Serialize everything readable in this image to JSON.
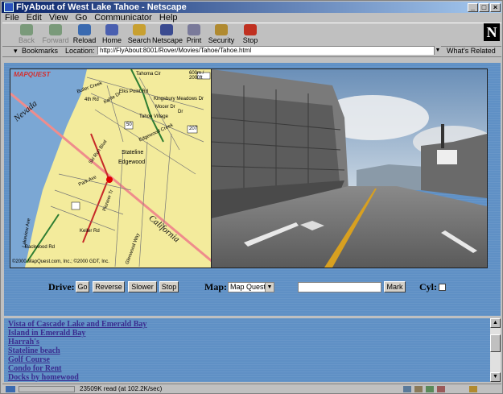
{
  "window": {
    "title": "FlyAbout of West Lake Tahoe - Netscape",
    "controls": [
      "_",
      "□",
      "×"
    ]
  },
  "menubar": [
    "File",
    "Edit",
    "View",
    "Go",
    "Communicator",
    "Help"
  ],
  "toolbar": {
    "buttons": [
      {
        "label": "Back",
        "icon": "back-arrow-icon",
        "enabled": false
      },
      {
        "label": "Forward",
        "icon": "forward-arrow-icon",
        "enabled": false
      },
      {
        "label": "Reload",
        "icon": "reload-icon",
        "enabled": true
      },
      {
        "label": "Home",
        "icon": "home-icon",
        "enabled": true
      },
      {
        "label": "Search",
        "icon": "search-icon",
        "enabled": true
      },
      {
        "label": "Netscape",
        "icon": "netscape-icon",
        "enabled": true
      },
      {
        "label": "Print",
        "icon": "print-icon",
        "enabled": true
      },
      {
        "label": "Security",
        "icon": "lock-icon",
        "enabled": true
      },
      {
        "label": "Stop",
        "icon": "stop-icon",
        "enabled": true
      }
    ]
  },
  "location_bar": {
    "bookmarks_label": "Bookmarks",
    "location_label": "Location:",
    "url": "http://FlyAbout:8001/Rover/Movies/Tahoe/Tahoe.html",
    "whats_related": "What's Related"
  },
  "map": {
    "brand": "MAPQUEST",
    "scale": "600m / 2000ft",
    "copyright": "©2000 MapQuest.com, Inc.; ©2000 GDT, Inc.",
    "labels": [
      "Nevada",
      "California",
      "Tahoma Cir",
      "Buller Creek",
      "Kahle Dr",
      "4th Rd",
      "Elks Point Rd",
      "Mocer Dr",
      "Kingsbury Meadows Dr",
      "Tahoe Village",
      "Dr",
      "Edgewood Creek",
      "Stateline",
      "Edgewood",
      "Park Ave",
      "Pioneer Tr",
      "Ski Run Blvd",
      "Keller Rd",
      "Backwood Rd",
      "Glenwood Way",
      "Lakeview Ave",
      "50",
      "207"
    ]
  },
  "controls": {
    "drive_label": "Drive:",
    "go_label": "Go",
    "reverse_label": "Reverse",
    "slower_label": "Slower",
    "stop_label": "Stop",
    "map_label": "Map:",
    "map_select_value": "Map Quest",
    "text_input_value": "",
    "mark_label": "Mark",
    "cyl_label": "Cyl:",
    "cyl_checked": false
  },
  "links": [
    "Vista of Cascade Lake and Emerald Bay",
    "Island in Emerald Bay",
    "Harrah's",
    "Stateline beach",
    "Golf Course",
    "Condo for Rent",
    "Docks by homewood"
  ],
  "status": {
    "text": "23509K read (at 102.2K/sec)"
  },
  "colors": {
    "content_bg": "#5f90c5",
    "title_start": "#0a246a",
    "title_end": "#a6caf0",
    "link": "#3a2c8f"
  }
}
